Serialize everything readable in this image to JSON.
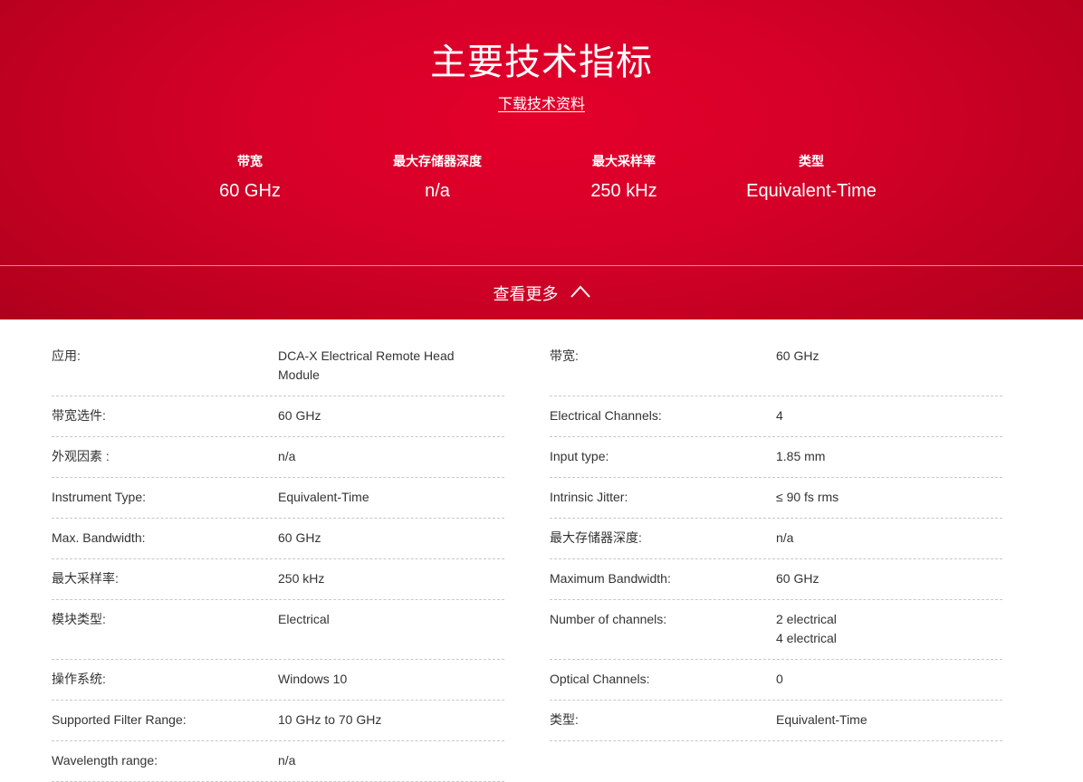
{
  "hero": {
    "title": "主要技术指标",
    "download_label": "下载技术资料",
    "metrics": [
      {
        "label": "带宽",
        "value": "60 GHz"
      },
      {
        "label": "最大存储器深度",
        "value": "n/a"
      },
      {
        "label": "最大采样率",
        "value": "250 kHz"
      },
      {
        "label": "类型",
        "value": "Equivalent-Time"
      }
    ],
    "view_more_label": "查看更多"
  },
  "specs": {
    "left": [
      {
        "key": "应用:",
        "value_lines": [
          "DCA-X Electrical Remote Head",
          "Module"
        ]
      },
      {
        "key": "带宽选件:",
        "value_lines": [
          "60 GHz"
        ]
      },
      {
        "key": "外观因素 :",
        "value_lines": [
          "n/a"
        ]
      },
      {
        "key": "Instrument Type:",
        "value_lines": [
          "Equivalent-Time"
        ]
      },
      {
        "key": "Max. Bandwidth:",
        "value_lines": [
          "60 GHz"
        ]
      },
      {
        "key": "最大采样率:",
        "value_lines": [
          "250 kHz"
        ]
      },
      {
        "key": "模块类型:",
        "value_lines": [
          "Electrical"
        ]
      },
      {
        "key": "操作系统:",
        "value_lines": [
          "Windows 10"
        ]
      },
      {
        "key": "Supported Filter Range:",
        "value_lines": [
          "10 GHz to 70 GHz"
        ]
      },
      {
        "key": "Wavelength range:",
        "value_lines": [
          "n/a"
        ]
      }
    ],
    "right": [
      {
        "key": "带宽:",
        "value_lines": [
          "60 GHz"
        ]
      },
      {
        "key": "Electrical Channels:",
        "value_lines": [
          "4"
        ]
      },
      {
        "key": "Input type:",
        "value_lines": [
          "1.85 mm"
        ]
      },
      {
        "key": "Intrinsic Jitter:",
        "value_lines": [
          "≤ 90 fs rms"
        ]
      },
      {
        "key": "最大存储器深度:",
        "value_lines": [
          "n/a"
        ]
      },
      {
        "key": "Maximum Bandwidth:",
        "value_lines": [
          "60 GHz"
        ]
      },
      {
        "key": "Number of channels:",
        "value_lines": [
          "2 electrical",
          "4 electrical"
        ]
      },
      {
        "key": "Optical Channels:",
        "value_lines": [
          "0"
        ]
      },
      {
        "key": "类型:",
        "value_lines": [
          "Equivalent-Time"
        ]
      }
    ]
  },
  "icons": {
    "view_more": "chevron-up-icon"
  },
  "colors": {
    "brand_red": "#e4002b",
    "dark_red": "#a3001b",
    "divider_dash": "#c8c8c8",
    "text": "#333333"
  }
}
